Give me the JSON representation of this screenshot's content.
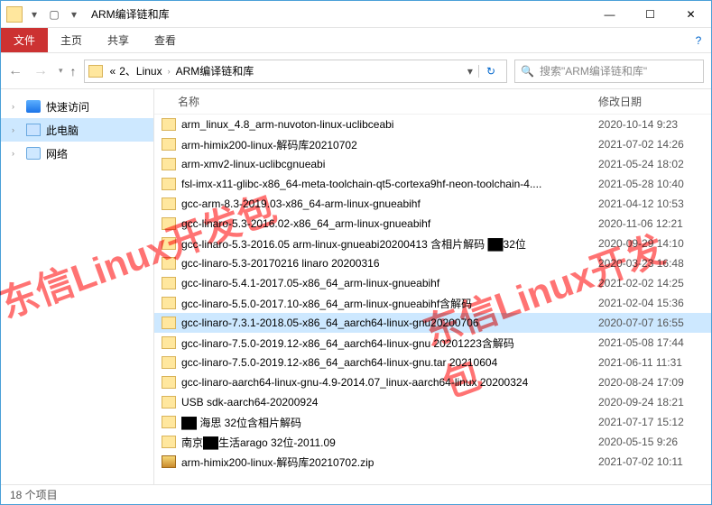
{
  "window": {
    "title": "ARM编译链和库",
    "min": "—",
    "max": "☐",
    "close": "✕"
  },
  "menubar": {
    "file": "文件",
    "home": "主页",
    "share": "共享",
    "view": "查看",
    "help": "?"
  },
  "breadcrumb": {
    "sep": "›",
    "root": "«",
    "items": [
      "2、Linux",
      "ARM编译链和库"
    ]
  },
  "search": {
    "placeholder": "搜索\"ARM编译链和库\""
  },
  "sidebar": {
    "items": [
      {
        "label": "快速访问",
        "icon": "quick"
      },
      {
        "label": "此电脑",
        "icon": "pc",
        "selected": true
      },
      {
        "label": "网络",
        "icon": "net"
      }
    ]
  },
  "columns": {
    "name": "名称",
    "date": "修改日期"
  },
  "files": [
    {
      "name": "arm_linux_4.8_arm-nuvoton-linux-uclibceabi",
      "date": "2020-10-14 9:23",
      "type": "folder"
    },
    {
      "name": "arm-himix200-linux-解码库20210702",
      "date": "2021-07-02 14:26",
      "type": "folder"
    },
    {
      "name": "arm-xmv2-linux-uclibcgnueabi",
      "date": "2021-05-24 18:02",
      "type": "folder"
    },
    {
      "name": "fsl-imx-x11-glibc-x86_64-meta-toolchain-qt5-cortexa9hf-neon-toolchain-4....",
      "date": "2021-05-28 10:40",
      "type": "folder"
    },
    {
      "name": "gcc-arm-8.3-2019.03-x86_64-arm-linux-gnueabihf",
      "date": "2021-04-12 10:53",
      "type": "folder"
    },
    {
      "name": "gcc-linaro-5.3-2016.02-x86_64_arm-linux-gnueabihf",
      "date": "2020-11-06 12:21",
      "type": "folder"
    },
    {
      "name": "gcc-linaro-5.3-2016.05 arm-linux-gnueabi20200413 含相片解码 ██32位",
      "date": "2020-09-29 14:10",
      "type": "folder"
    },
    {
      "name": "gcc-linaro-5.3-20170216 linaro 20200316",
      "date": "2020-03-23 16:48",
      "type": "folder"
    },
    {
      "name": "gcc-linaro-5.4.1-2017.05-x86_64_arm-linux-gnueabihf",
      "date": "2021-02-02 14:25",
      "type": "folder"
    },
    {
      "name": "gcc-linaro-5.5.0-2017.10-x86_64_arm-linux-gnueabihf含解码",
      "date": "2021-02-04 15:36",
      "type": "folder"
    },
    {
      "name": "gcc-linaro-7.3.1-2018.05-x86_64_aarch64-linux-gnu20200706",
      "date": "2020-07-07 16:55",
      "type": "folder",
      "selected": true
    },
    {
      "name": "gcc-linaro-7.5.0-2019.12-x86_64_aarch64-linux-gnu 20201223含解码",
      "date": "2021-05-08 17:44",
      "type": "folder"
    },
    {
      "name": "gcc-linaro-7.5.0-2019.12-x86_64_aarch64-linux-gnu.tar 20210604",
      "date": "2021-06-11 11:31",
      "type": "folder"
    },
    {
      "name": "gcc-linaro-aarch64-linux-gnu-4.9-2014.07_linux-aarch64-linux 20200324",
      "date": "2020-08-24 17:09",
      "type": "folder"
    },
    {
      "name": "USB sdk-aarch64-20200924",
      "date": "2020-09-24 18:21",
      "type": "folder"
    },
    {
      "name": "██ 海思 32位含相片解码",
      "date": "2021-07-17 15:12",
      "type": "folder"
    },
    {
      "name": "南京██生活arago 32位-2011.09",
      "date": "2020-05-15 9:26",
      "type": "folder"
    },
    {
      "name": "arm-himix200-linux-解码库20210702.zip",
      "date": "2021-07-02 10:11",
      "type": "zip"
    }
  ],
  "status": {
    "count": "18 个项目"
  },
  "watermark": {
    "text1": "东信Linux开发包",
    "text2": "东信Linux开发包"
  }
}
